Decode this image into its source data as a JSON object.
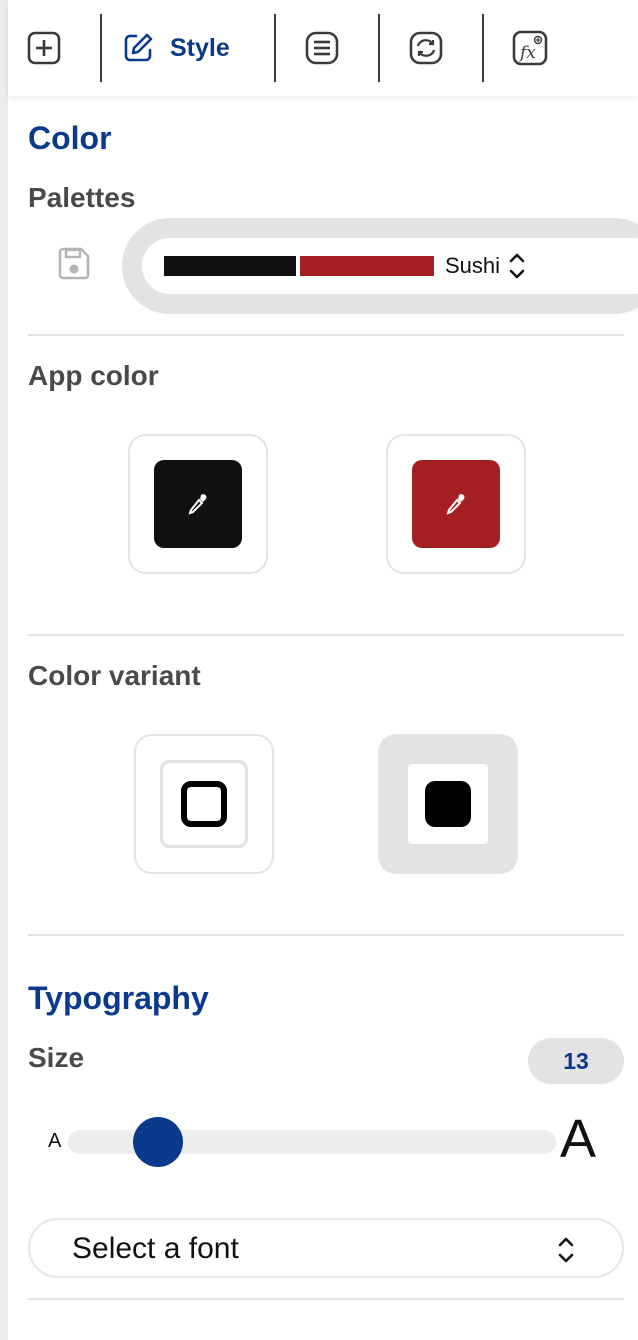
{
  "toolbar": {
    "style_label": "Style",
    "icons": [
      "add-icon",
      "edit-icon",
      "list-icon",
      "refresh-icon",
      "function-icon"
    ]
  },
  "color_section": {
    "title": "Color",
    "palettes_label": "Palettes",
    "palette": {
      "name": "Sushi",
      "colors": [
        "#111111",
        "#a51f22"
      ]
    }
  },
  "app_color": {
    "label": "App color",
    "colors": [
      "#111111",
      "#a51f22"
    ]
  },
  "color_variant": {
    "label": "Color variant",
    "options": [
      "outline",
      "filled"
    ],
    "selected": "filled"
  },
  "typography": {
    "title": "Typography",
    "size_label": "Size",
    "size_value": "13",
    "slider_small_label": "A",
    "slider_large_label": "A",
    "slider_fraction": 0.14,
    "font_placeholder": "Select a font"
  },
  "colors": {
    "accent": "#0b3a8c",
    "divider": "#e3e3e3",
    "dark": "#111111",
    "red": "#a51f22"
  }
}
